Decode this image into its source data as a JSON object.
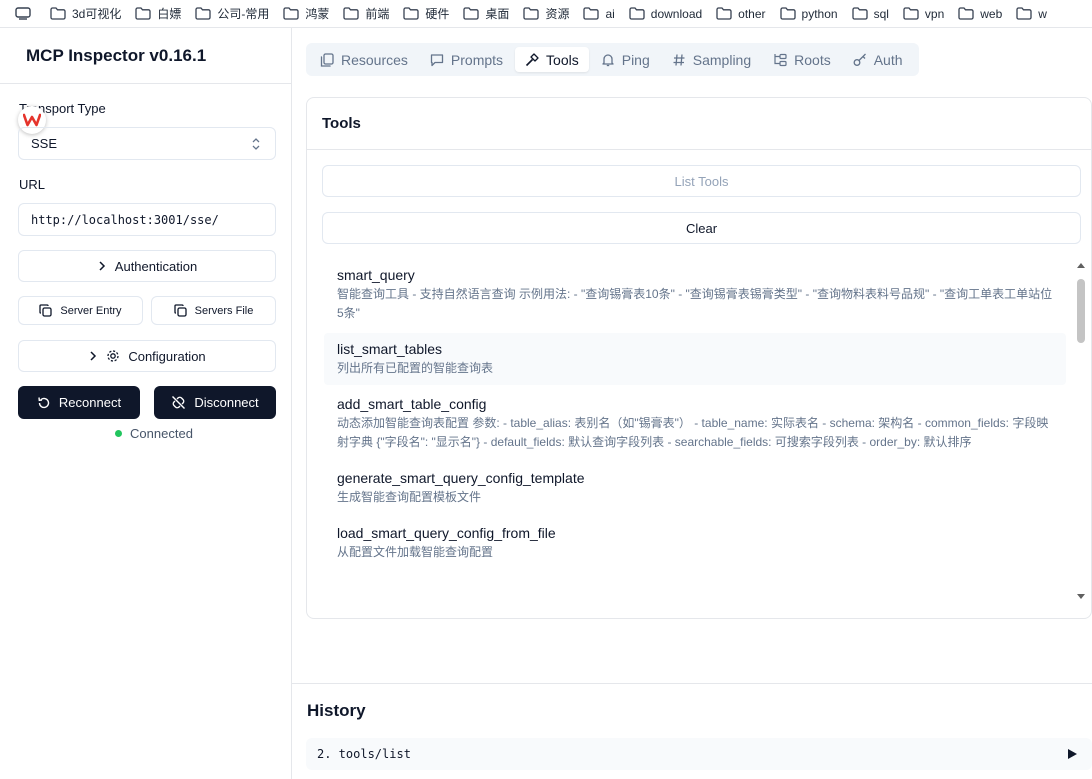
{
  "bookmarks": [
    "3d可视化",
    "白嫖",
    "公司-常用",
    "鸿蒙",
    "前端",
    "硬件",
    "桌面",
    "资源",
    "ai",
    "download",
    "other",
    "python",
    "sql",
    "vpn",
    "web",
    "w"
  ],
  "sidebar": {
    "title": "MCP Inspector v0.16.1",
    "transport_label": "Transport Type",
    "transport_value": "SSE",
    "url_label": "URL",
    "url_value": "http://localhost:3001/sse/",
    "authentication": "Authentication",
    "server_entry": "Server Entry",
    "servers_file": "Servers File",
    "configuration": "Configuration",
    "reconnect": "Reconnect",
    "disconnect": "Disconnect",
    "status": "Connected"
  },
  "tabs": [
    {
      "label": "Resources",
      "icon": "files-icon"
    },
    {
      "label": "Prompts",
      "icon": "message-icon"
    },
    {
      "label": "Tools",
      "icon": "hammer-icon"
    },
    {
      "label": "Ping",
      "icon": "bell-icon"
    },
    {
      "label": "Sampling",
      "icon": "hash-icon"
    },
    {
      "label": "Roots",
      "icon": "folder-tree-icon"
    },
    {
      "label": "Auth",
      "icon": "key-icon"
    }
  ],
  "active_tab": "Tools",
  "tools_panel": {
    "title": "Tools",
    "list_button": "List Tools",
    "clear_button": "Clear",
    "items": [
      {
        "name": "smart_query",
        "desc": "智能查询工具 - 支持自然语言查询 示例用法: - \"查询锡膏表10条\" - \"查询锡膏表锡膏类型\" - \"查询物料表料号品规\" - \"查询工单表工单站位5条\""
      },
      {
        "name": "list_smart_tables",
        "desc": "列出所有已配置的智能查询表"
      },
      {
        "name": "add_smart_table_config",
        "desc": "动态添加智能查询表配置 参数: - table_alias: 表别名（如\"锡膏表\"） - table_name: 实际表名 - schema: 架构名 - common_fields: 字段映射字典 {\"字段名\": \"显示名\"} - default_fields: 默认查询字段列表 - searchable_fields: 可搜索字段列表 - order_by: 默认排序"
      },
      {
        "name": "generate_smart_query_config_template",
        "desc": "生成智能查询配置模板文件"
      },
      {
        "name": "load_smart_query_config_from_file",
        "desc": "从配置文件加载智能查询配置"
      }
    ]
  },
  "history": {
    "title": "History",
    "entries": [
      "2. tools/list"
    ]
  },
  "colors": {
    "primary_dark": "#0f172a",
    "connected": "#22c55e",
    "muted_text": "#64748b"
  }
}
